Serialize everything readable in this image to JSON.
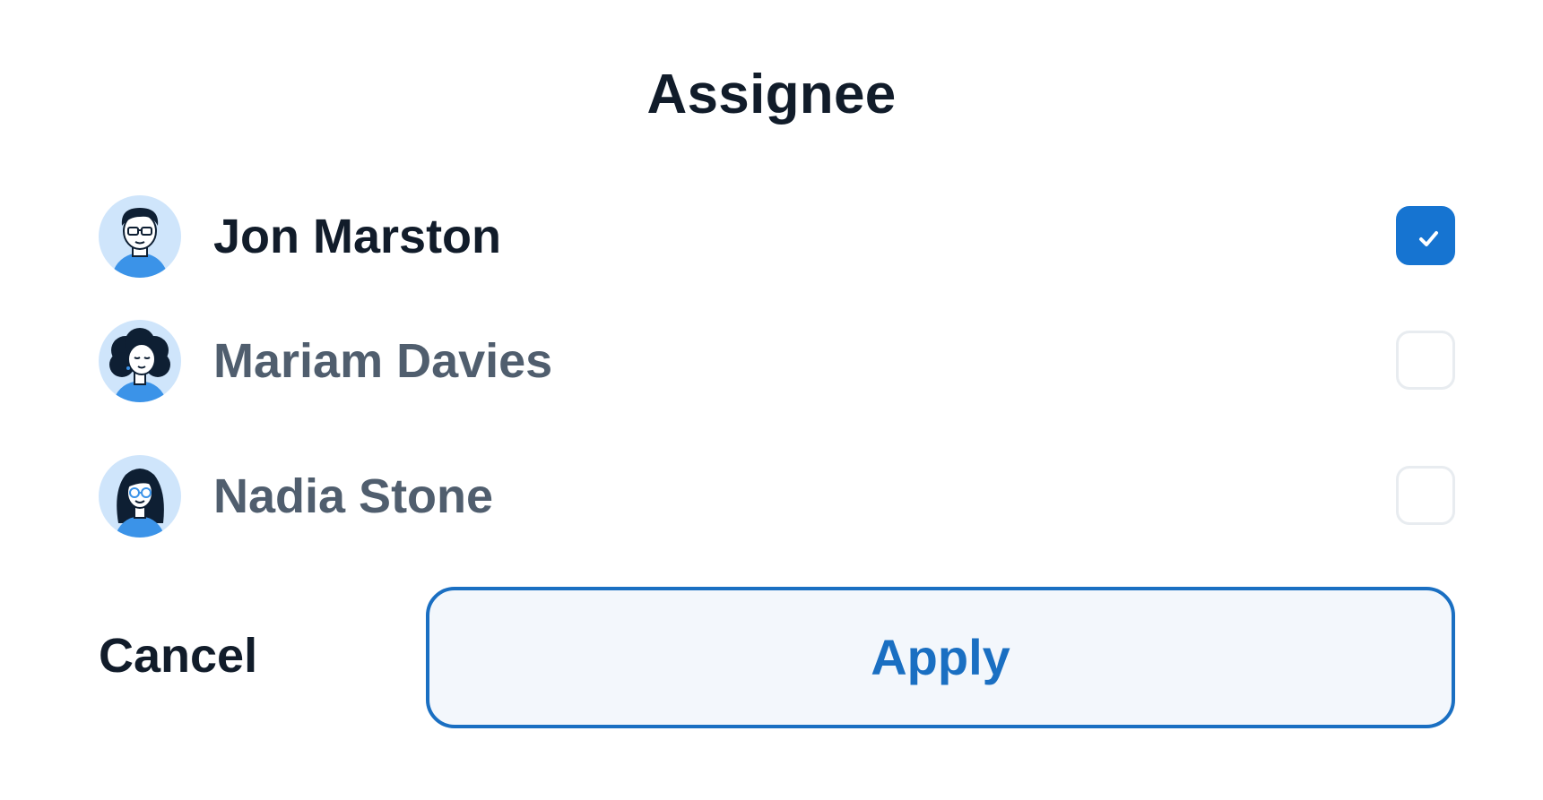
{
  "dialog": {
    "title": "Assignee",
    "assignees": [
      {
        "name": "Jon Marston",
        "checked": true,
        "avatar_icon": "man-with-glasses-avatar"
      },
      {
        "name": "Mariam Davies",
        "checked": false,
        "avatar_icon": "woman-curly-hair-avatar"
      },
      {
        "name": "Nadia Stone",
        "checked": false,
        "avatar_icon": "woman-glasses-long-hair-avatar"
      }
    ],
    "cancel_label": "Cancel",
    "apply_label": "Apply"
  },
  "colors": {
    "accent": "#1674d1",
    "apply_border": "#1a6fc2",
    "apply_background": "#f3f7fc",
    "text_primary": "#111c2a",
    "text_secondary": "#505e6e",
    "avatar_background": "#cfe5fb",
    "checkbox_border": "#e8ecf0"
  }
}
